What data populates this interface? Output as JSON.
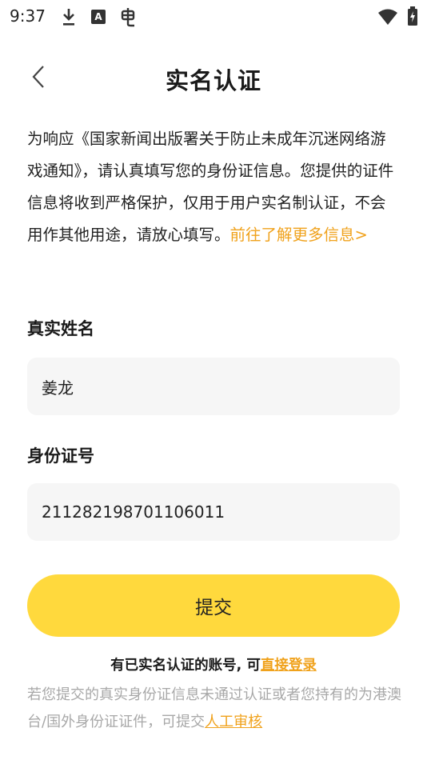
{
  "status_bar": {
    "time": "9:37",
    "a_icon_label": "A",
    "icons": [
      "download-icon",
      "a-icon",
      "bug-icon",
      "wifi-icon",
      "battery-icon"
    ]
  },
  "header": {
    "title": "实名认证",
    "back_icon": "chevron-left-icon"
  },
  "notice": {
    "text": "为响应《国家新闻出版署关于防止未成年沉迷网络游戏通知》，请认真填写您的身份证信息。您提供的证件信息将收到严格保护，仅用于用户实名制认证，不会用作其他用途，请放心填写。",
    "link": "前往了解更多信息>"
  },
  "form": {
    "name_label": "真实姓名",
    "name_value": "姜龙",
    "id_label": "身份证号",
    "id_value": "211282198701106011",
    "submit_label": "提交"
  },
  "footer": {
    "login_prompt": "有已实名认证的账号, 可",
    "login_link": "直接登录",
    "note_text": "若您提交的真实身份证信息未通过认证或者您持有的为港澳台/国外身份证证件，可提交",
    "manual_link": "人工审核"
  },
  "colors": {
    "accent": "#f0a21c",
    "button": "#ffd93d",
    "input_bg": "#f6f6f6",
    "muted": "#a8a8a8"
  }
}
